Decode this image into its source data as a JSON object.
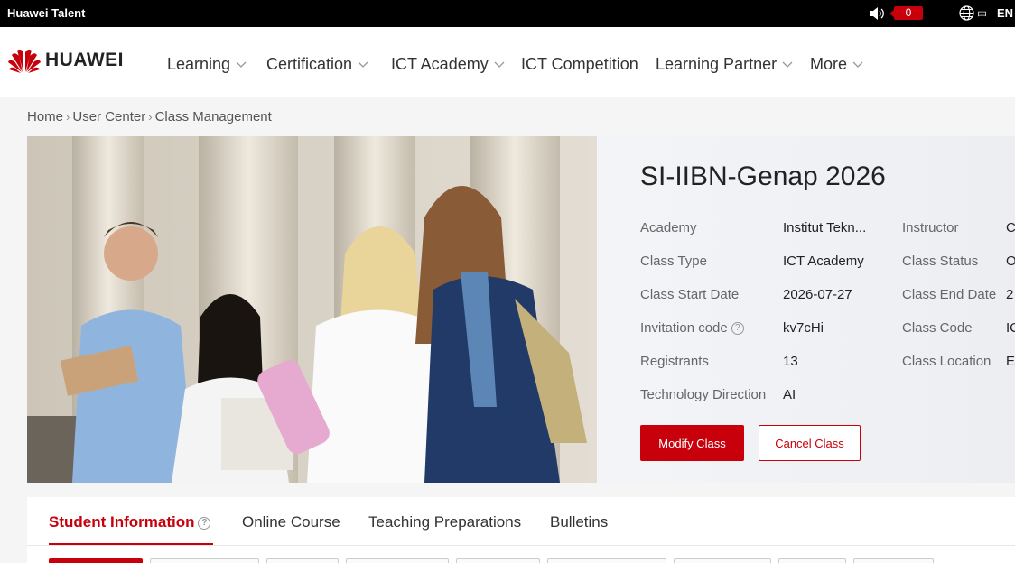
{
  "topbar": {
    "brand": "Huawei Talent",
    "notification_count": "0",
    "lang_zh": "中",
    "lang_en": "EN"
  },
  "logo": {
    "text": "HUAWEI"
  },
  "nav": [
    {
      "label": "Learning",
      "dropdown": true
    },
    {
      "label": "Certification",
      "dropdown": true
    },
    {
      "label": "ICT Academy",
      "dropdown": true
    },
    {
      "label": "ICT Competition",
      "dropdown": false
    },
    {
      "label": "Learning Partner",
      "dropdown": true
    },
    {
      "label": "More",
      "dropdown": true
    }
  ],
  "breadcrumb": [
    "Home",
    "User Center",
    "Class Management"
  ],
  "class_info": {
    "title": "SI-IIBN-Genap 2026",
    "left": [
      {
        "label": "Academy",
        "value": "Institut Tekn..."
      },
      {
        "label": "Class Type",
        "value": "ICT Academy"
      },
      {
        "label": "Class Start Date",
        "value": "2026-07-27"
      },
      {
        "label": "Invitation code",
        "value": "kv7cHi"
      },
      {
        "label": "Registrants",
        "value": "13"
      },
      {
        "label": "Technology Direction",
        "value": "AI"
      }
    ],
    "right": [
      {
        "label": "Instructor",
        "value": "C"
      },
      {
        "label": "Class Status",
        "value": "O"
      },
      {
        "label": "Class End Date",
        "value": "2"
      },
      {
        "label": "Class Code",
        "value": "IC"
      },
      {
        "label": "Class Location",
        "value": "E-"
      }
    ],
    "help_glyph": "?",
    "modify_label": "Modify Class",
    "cancel_label": "Cancel Class"
  },
  "tabs": [
    {
      "label": "Student Information",
      "active": true
    },
    {
      "label": "Online Course",
      "active": false
    },
    {
      "label": "Teaching Preparations",
      "active": false
    },
    {
      "label": "Bulletins",
      "active": false
    }
  ],
  "colors": {
    "brand_red": "#c7000b",
    "topbar_bg": "#000000",
    "hero_bg": "#eef0f3"
  }
}
